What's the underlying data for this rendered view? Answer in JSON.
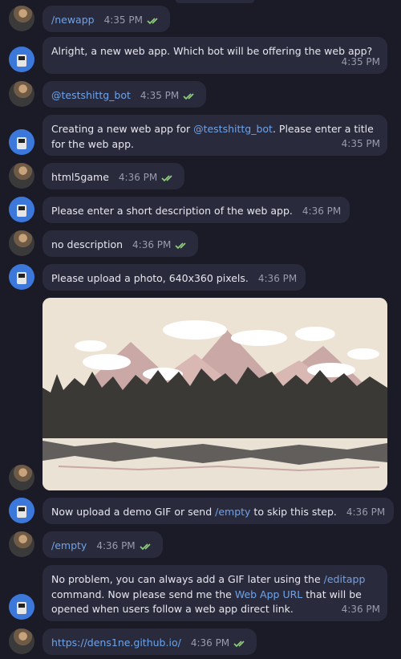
{
  "colors": {
    "background": "#1b1a27",
    "bubble": "#2a2a3d",
    "link": "#6ea3e8",
    "check": "#8fd17a",
    "time": "#9a9bae"
  },
  "messages": [
    {
      "time": "4:35 PM",
      "text": "/newapp"
    },
    {
      "time": "4:35 PM",
      "text": "Alright, a new web app. Which bot will be offering the web app?"
    },
    {
      "time": "4:35 PM",
      "text": "@testshittg_bot"
    },
    {
      "time": "4:35 PM",
      "text_before": "Creating a new web app for ",
      "link": "@testshittg_bot",
      "text_after": ". Please enter a title for the web app."
    },
    {
      "time": "4:36 PM",
      "text": "html5game"
    },
    {
      "time": "4:36 PM",
      "text": "Please enter a short description of the web app."
    },
    {
      "time": "4:36 PM",
      "text": "no description"
    },
    {
      "time": "4:36 PM",
      "text": "Please upload a photo, 640x360 pixels."
    },
    {
      "time": "4:36 PM",
      "text_before": "Now upload a demo GIF or send ",
      "link": "/empty",
      "text_after": " to skip this step."
    },
    {
      "time": "4:36 PM",
      "text": "/empty"
    },
    {
      "time": "4:36 PM",
      "text_before": "No problem, you can always add a GIF later using the ",
      "link": "/editapp",
      "text_mid": " command. Now please send me the ",
      "link2": "Web App URL",
      "text_after": " that will be opened when users follow a web app direct link."
    },
    {
      "time": "4:36 PM",
      "text": "https://dens1ne.github.io/"
    }
  ]
}
